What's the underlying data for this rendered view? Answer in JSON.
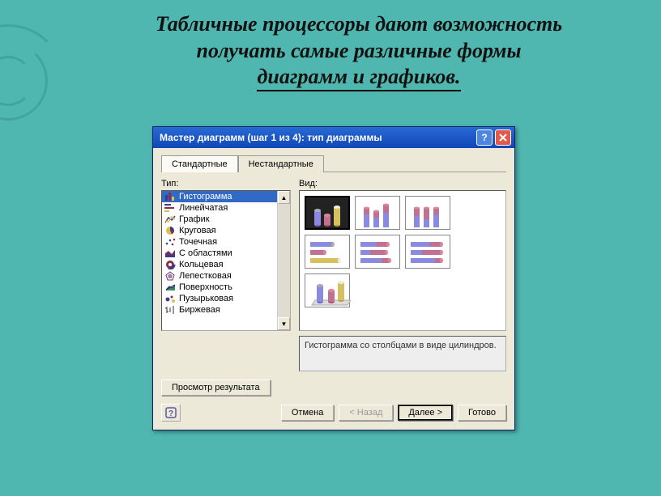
{
  "headline": {
    "line1": "Табличные процессоры дают возможность",
    "line2": "получать самые различные формы",
    "line3": "диаграмм и графиков."
  },
  "dialog": {
    "title": "Мастер диаграмм (шаг 1 из 4): тип диаграммы",
    "tabs": {
      "standard": "Стандартные",
      "nonstandard": "Нестандартные"
    },
    "labels": {
      "type": "Тип:",
      "view": "Вид:"
    },
    "types": [
      {
        "label": "Гистограмма",
        "icon": "bar-icon"
      },
      {
        "label": "Линейчатая",
        "icon": "hbar-icon"
      },
      {
        "label": "График",
        "icon": "line-icon"
      },
      {
        "label": "Круговая",
        "icon": "pie-icon"
      },
      {
        "label": "Точечная",
        "icon": "scatter-icon"
      },
      {
        "label": "С областями",
        "icon": "area-icon"
      },
      {
        "label": "Кольцевая",
        "icon": "donut-icon"
      },
      {
        "label": "Лепестковая",
        "icon": "radar-icon"
      },
      {
        "label": "Поверхность",
        "icon": "surface-icon"
      },
      {
        "label": "Пузырьковая",
        "icon": "bubble-icon"
      },
      {
        "label": "Биржевая",
        "icon": "stock-icon"
      }
    ],
    "description": "Гистограмма со столбцами в виде цилиндров.",
    "buttons": {
      "preview": "Просмотр результата",
      "cancel": "Отмена",
      "back": "< Назад",
      "next": "Далее >",
      "finish": "Готово"
    }
  }
}
